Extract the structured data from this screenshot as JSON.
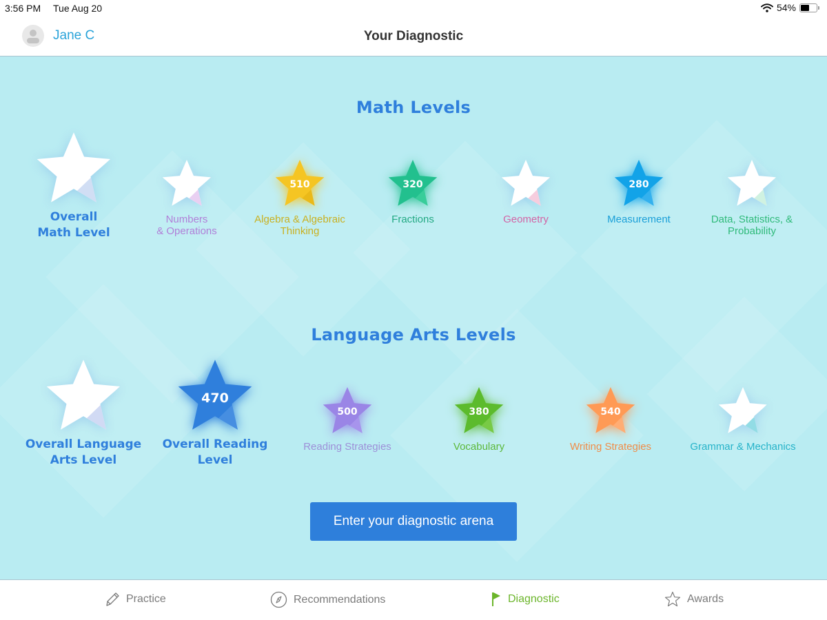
{
  "status_bar": {
    "time": "3:56 PM",
    "date": "Tue Aug 20",
    "battery_percent": "54%",
    "battery_level": 0.54,
    "wifi_icon": "wifi-icon",
    "battery_icon": "battery-icon"
  },
  "header": {
    "user_name": "Jane C",
    "avatar_icon": "person-icon",
    "title": "Your Diagnostic"
  },
  "math": {
    "title": "Math Levels",
    "items": [
      {
        "label": "Overall Math Level",
        "label_lines": [
          "Overall",
          "Math Level"
        ],
        "value": null,
        "color": "#ffffff",
        "shade": "#c9d8f2",
        "text_color": "#2f7fdc",
        "size": "large"
      },
      {
        "label": "Numbers & Operations",
        "label_lines": [
          "Numbers",
          "& Operations"
        ],
        "value": null,
        "color": "#ffffff",
        "shade": "#e5c8f0",
        "text_color": "#b07fd8",
        "size": "small"
      },
      {
        "label": "Algebra & Algebraic Thinking",
        "label_lines": [
          "Algebra & Algebraic",
          "Thinking"
        ],
        "value": "510",
        "color": "#f5c523",
        "shade": "#e8b618",
        "text_color": "#c9b020",
        "size": "small"
      },
      {
        "label": "Fractions",
        "label_lines": [
          "Fractions"
        ],
        "value": "320",
        "color": "#22c08e",
        "shade": "#3ccf9c",
        "text_color": "#22a983",
        "size": "small"
      },
      {
        "label": "Geometry",
        "label_lines": [
          "Geometry"
        ],
        "value": null,
        "color": "#ffffff",
        "shade": "#f5c4d8",
        "text_color": "#d264a5",
        "size": "small"
      },
      {
        "label": "Measurement",
        "label_lines": [
          "Measurement"
        ],
        "value": "280",
        "color": "#12a3e8",
        "shade": "#3bb4ee",
        "text_color": "#1a9fd8",
        "size": "small"
      },
      {
        "label": "Data, Statistics, & Probability",
        "label_lines": [
          "Data, Statistics, &",
          "Probability"
        ],
        "value": null,
        "color": "#ffffff",
        "shade": "#c8f0dc",
        "text_color": "#2fba7a",
        "size": "small"
      }
    ]
  },
  "language_arts": {
    "title": "Language Arts Levels",
    "items": [
      {
        "label": "Overall Language Arts Level",
        "label_lines": [
          "Overall Language",
          "Arts Level"
        ],
        "value": null,
        "color": "#ffffff",
        "shade": "#c9d4f2",
        "text_color": "#2f7fdc",
        "size": "large"
      },
      {
        "label": "Overall Reading Level",
        "label_lines": [
          "Overall Reading",
          "Level"
        ],
        "value": "470",
        "color": "#2f7fdc",
        "shade": "#4a90e2",
        "text_color": "#2f7fdc",
        "size": "large"
      },
      {
        "label": "Reading Strategies",
        "label_lines": [
          "Reading Strategies"
        ],
        "value": "500",
        "color": "#9a85e6",
        "shade": "#a996ec",
        "text_color": "#9d8fd8",
        "size": "small"
      },
      {
        "label": "Vocabulary",
        "label_lines": [
          "Vocabulary"
        ],
        "value": "380",
        "color": "#5cbb2c",
        "shade": "#7ccd4a",
        "text_color": "#5cb83a",
        "size": "small"
      },
      {
        "label": "Writing Strategies",
        "label_lines": [
          "Writing Strategies"
        ],
        "value": "540",
        "color": "#ff9a55",
        "shade": "#ffb07a",
        "text_color": "#f08c48",
        "size": "small"
      },
      {
        "label": "Grammar & Mechanics",
        "label_lines": [
          "Grammar & Mechanics"
        ],
        "value": null,
        "color": "#ffffff",
        "shade": "#7fd6e0",
        "text_color": "#26b3c9",
        "size": "small"
      }
    ]
  },
  "cta": {
    "label": "Enter your diagnostic arena"
  },
  "tabs": [
    {
      "label": "Practice",
      "icon": "pencil-icon",
      "active": false
    },
    {
      "label": "Recommendations",
      "icon": "compass-icon",
      "active": false
    },
    {
      "label": "Diagnostic",
      "icon": "flag-icon",
      "active": true
    },
    {
      "label": "Awards",
      "icon": "star-outline-icon",
      "active": false
    }
  ],
  "colors": {
    "accent_blue": "#2e7fdb",
    "background": "#b9ecf2",
    "active_tab": "#6bb52a",
    "inactive_tab": "#7a7a7a",
    "user_name": "#2aa3d9"
  }
}
